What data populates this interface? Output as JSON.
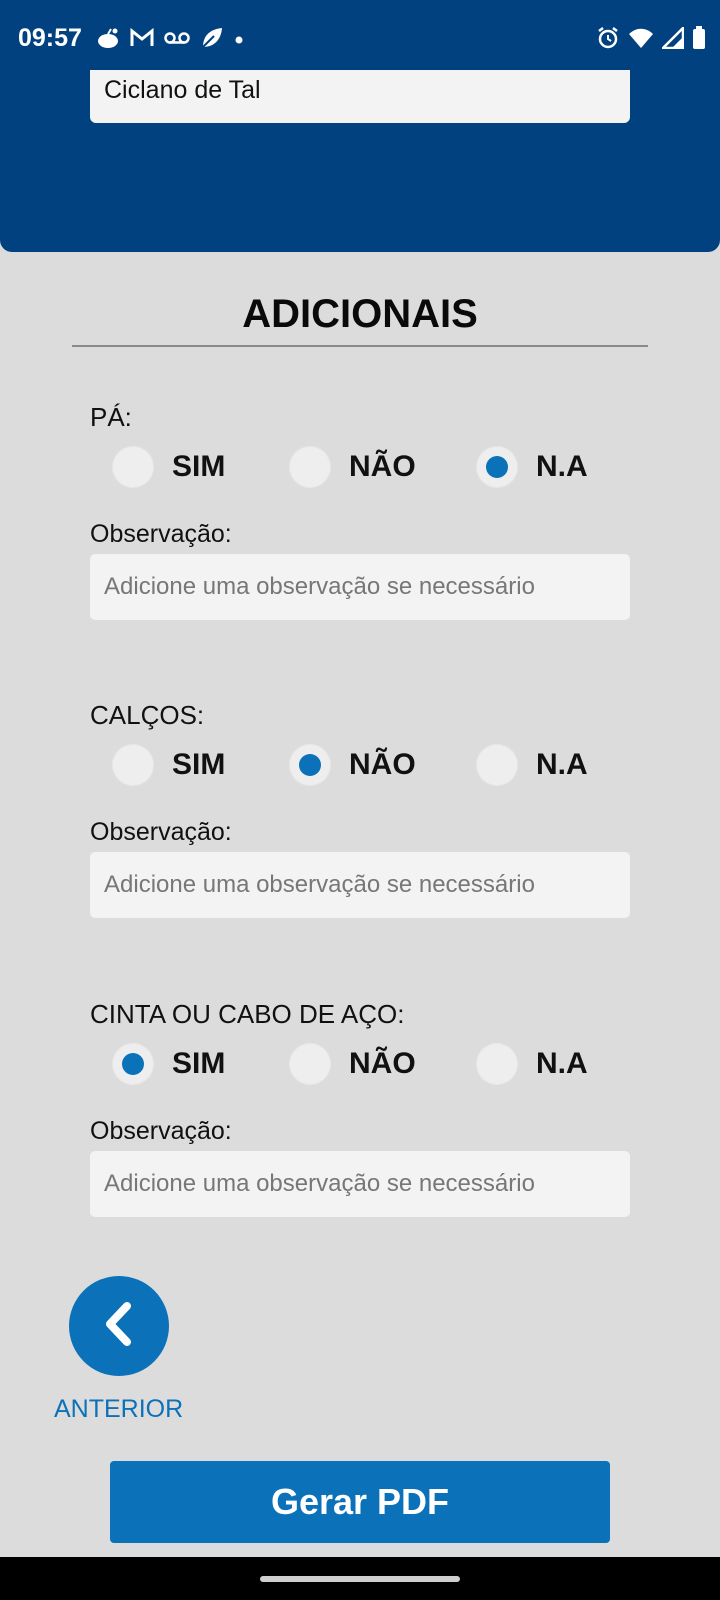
{
  "status_bar": {
    "time": "09:57",
    "left_icons": [
      "reddit-icon",
      "gmail-icon",
      "voicemail-icon",
      "leaf-icon",
      "dot-icon"
    ],
    "right_icons": [
      "alarm-icon",
      "wifi-icon",
      "signal-icon",
      "battery-icon"
    ]
  },
  "header": {
    "name_value": "Ciclano de Tal"
  },
  "section": {
    "title": "ADICIONAIS"
  },
  "options": {
    "sim": "SIM",
    "nao": "NÃO",
    "na": "N.A"
  },
  "groups": [
    {
      "label": "PÁ:",
      "selected": "N.A",
      "obs_label": "Observação:",
      "obs_placeholder": "Adicione uma observação se necessário"
    },
    {
      "label": "CALÇOS:",
      "selected": "NÃO",
      "obs_label": "Observação:",
      "obs_placeholder": "Adicione uma observação se necessário"
    },
    {
      "label": "CINTA OU CABO DE AÇO:",
      "selected": "SIM",
      "obs_label": "Observação:",
      "obs_placeholder": "Adicione uma observação se necessário"
    }
  ],
  "nav": {
    "previous_label": "ANTERIOR",
    "pdf_button": "Gerar PDF"
  },
  "colors": {
    "header_bg": "#02417f",
    "accent": "#0b71b9",
    "page_bg": "#dcdcdc"
  }
}
